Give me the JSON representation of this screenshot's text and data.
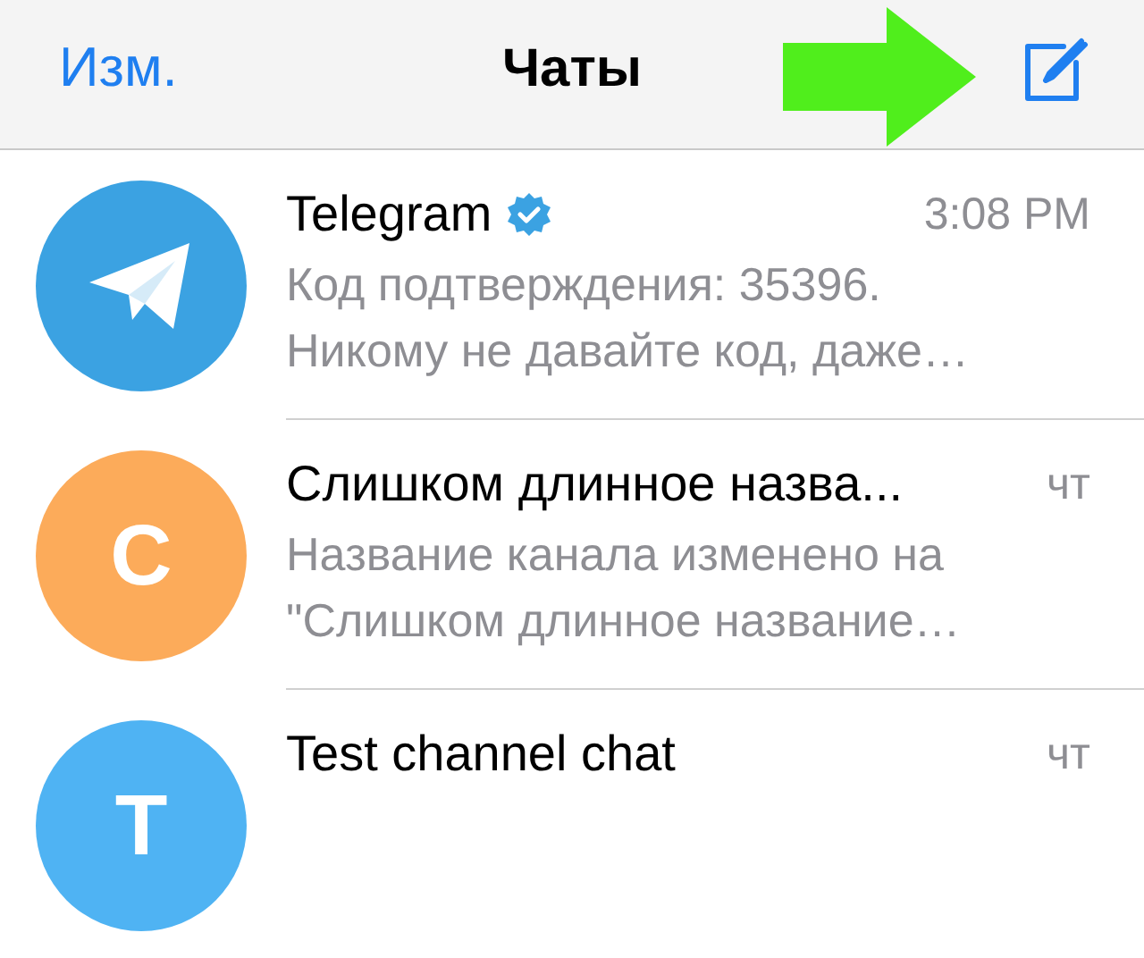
{
  "nav_bar": {
    "edit_label": "Изм.",
    "title": "Чаты"
  },
  "chats": [
    {
      "avatar": {
        "kind": "logo",
        "color": "#3ba2e2"
      },
      "name": "Telegram",
      "verified": true,
      "time": "3:08 PM",
      "preview": [
        "Код подтверждения: 35396.",
        "Никому не давайте код, даже…"
      ]
    },
    {
      "avatar": {
        "kind": "letter",
        "letter": "С",
        "color": "#fcab5a"
      },
      "name": "Слишком длинное назва...",
      "verified": false,
      "time": "чт",
      "preview": [
        "Название канала изменено на",
        "\"Слишком длинное название…"
      ]
    },
    {
      "avatar": {
        "kind": "letter",
        "letter": "T",
        "color": "#4fb3f3"
      },
      "name": "Test channel chat",
      "verified": false,
      "time": "чт"
    }
  ]
}
